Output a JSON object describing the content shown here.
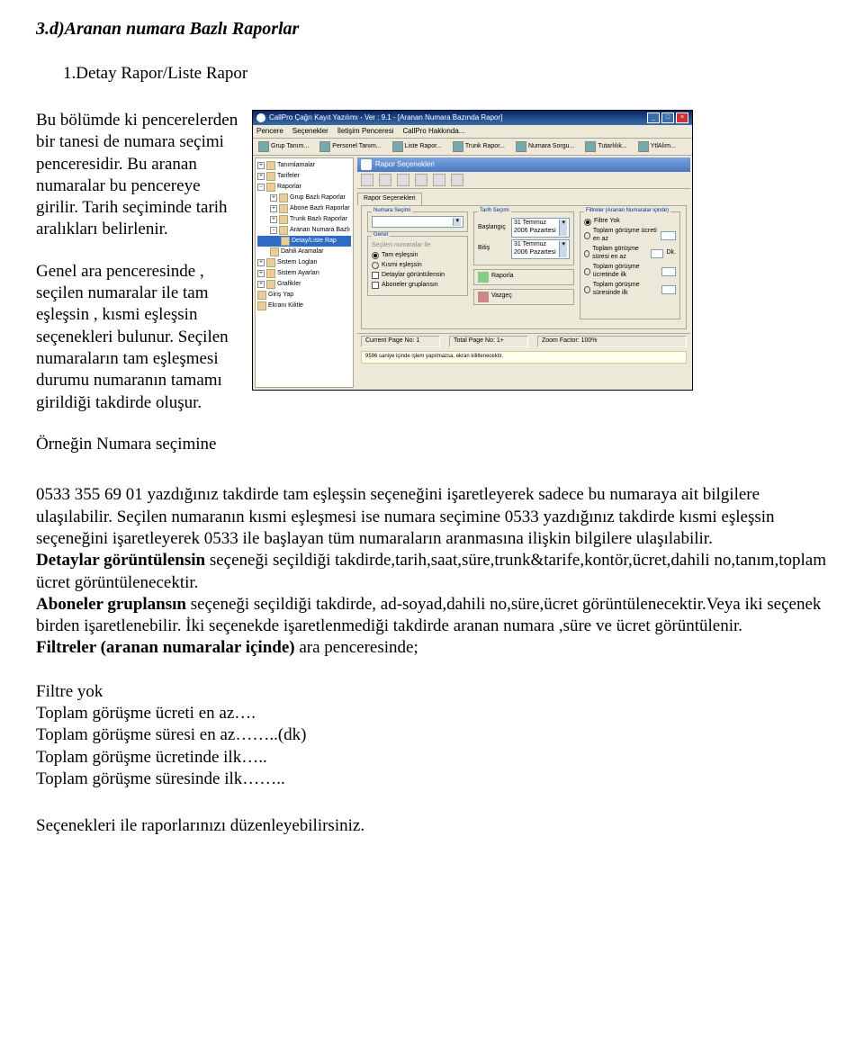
{
  "heading": "3.d)Aranan numara  Bazlı Raporlar",
  "subheading": "1.Detay Rapor/Liste Rapor",
  "para1": "Bu bölümde ki pencerelerden bir tanesi de numara seçimi penceresidir. Bu aranan numaralar bu pencereye girilir. Tarih seçiminde tarih aralıkları belirlenir.",
  "para2": "Genel ara penceresinde , seçilen numaralar ile tam eşleşsin , kısmi eşleşsin seçenekleri bulunur. Seçilen numaraların tam eşleşmesi durumu numaranın tamamı girildiği takdirde oluşur.",
  "body1": "Örneğin Numara seçimine",
  "body2": "0533 355 69 01 yazdığınız takdirde tam eşleşsin seçeneğini işaretleyerek sadece  bu numaraya ait bilgilere ulaşılabilir. Seçilen numaranın kısmi eşleşmesi ise numara seçimine 0533 yazdığınız takdirde kısmi eşleşsin seçeneğini işaretleyerek 0533 ile başlayan tüm numaraların aranmasına ilişkin bilgilere ulaşılabilir.",
  "body3a": "Detaylar görüntülensin",
  "body3b": " seçeneği seçildiği takdirde,tarih,saat,süre,trunk&tarife,kontör,ücret,dahili no,tanım,toplam ücret görüntülenecektir.",
  "body4a": "Aboneler gruplansın",
  "body4b": " seçeneği seçildiği takdirde, ad-soyad,dahili no,süre,ücret görüntülenecektir.Veya iki seçenek birden işaretlenebilir. İki seçenekde işaretlenmediği takdirde aranan numara ,süre ve ücret görüntülenir.",
  "body5a": "Filtreler (aranan numaralar içinde)",
  "body5b": " ara penceresinde;",
  "list": {
    "l1": "Filtre yok",
    "l2": "Toplam görüşme ücreti  en az….",
    "l3": "Toplam görüşme süresi en az……..(dk)",
    "l4": "Toplam görüşme ücretinde ilk…..",
    "l5": "Toplam görüşme süresinde ilk…….."
  },
  "footer": "Seçenekleri ile raporlarınızı düzenleyebilirsiniz.",
  "app": {
    "title": "CallPro Çağrı Kayıt Yazılımı - Ver : 9.1 - [Aranan Numara Bazında Rapor]",
    "menu": [
      "Pencere",
      "Seçenekler",
      "İletişim Penceresi",
      "CallPro Hakkında..."
    ],
    "toolbar": [
      "Grup Tanım...",
      "Personel Tanım...",
      "Liste Rapor...",
      "Trunk Rapor...",
      "Numara Sorgu...",
      "Tutarlılık...",
      "YtlAlım..."
    ],
    "tree": [
      "Tanımlamalar",
      "Tarifeler",
      "Raporlar",
      "Grup Bazlı Raporlar",
      "Abone Bazlı Raporlar",
      "Trunk Bazlı Raporlar",
      "Aranan Numara Bazlı",
      "Detay/Liste Rap",
      "Dahili Aramalar",
      "Sistem Logları",
      "Sistem Ayarları",
      "Grafikler",
      "Giriş Yap",
      "Ekranı Kilitle"
    ],
    "panel_title": "Rapor Seçenekleri",
    "tab": "Rapor Seçenekleri",
    "numara_secimi": "Numara Seçimi",
    "tarih_secimi": "Tarih Seçimi",
    "baslangic": "Başlangıç",
    "bitis": "Bitiş",
    "date": "31 Temmuz 2006 Pazartesi",
    "genel": "Genel",
    "secilen": "Seçilen numaralar ile",
    "tam": "Tam eşleşsin",
    "kismi": "Kısmi eşleşsin",
    "detaylar": "Detaylar görüntülensin",
    "aboneler": "Aboneler gruplansın",
    "raporla": "Raporla",
    "vazgec": "Vazgeç",
    "filtre_title": "Filtreler (Aranan Numaralar içinde)",
    "filtre_yok": "Filtre Yok",
    "f1": "Toplam görüşme ücreti en az",
    "f2": "Toplam görüşme süresi en az",
    "f3": "Toplam görüşme ücretinde ilk",
    "f4": "Toplam görüşme süresinde ilk",
    "dk": "Dk.",
    "status": {
      "cur": "Current Page No: 1",
      "tot": "Total Page No: 1+",
      "zoom": "Zoom Factor: 100%"
    },
    "msg": "9596 saniye içinde işlem yapılmazsa, ekran kilitlenecektir."
  }
}
